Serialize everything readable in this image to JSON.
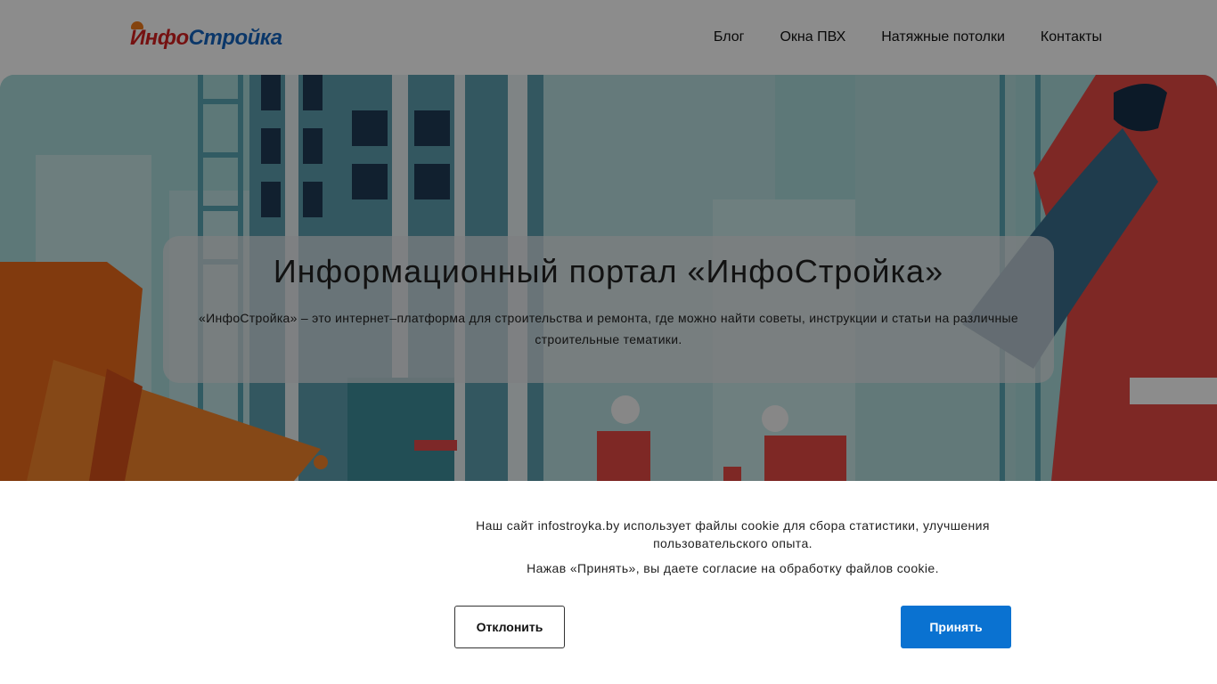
{
  "header": {
    "logo": {
      "part1": "Инфо",
      "part2": "Стройка"
    },
    "nav": [
      {
        "label": "Блог"
      },
      {
        "label": "Окна ПВХ"
      },
      {
        "label": "Натяжные потолки"
      },
      {
        "label": "Контакты"
      }
    ]
  },
  "hero": {
    "title": "Информационный портал «ИнфоСтройка»",
    "description": "«ИнфоСтройка» – это интернет–платформа для строительства и ремонта, где можно найти советы, инструкции и статьи на различные строительные тематики."
  },
  "cookie": {
    "text1": "Наш сайт infostroyka.by использует файлы cookie для сбора статистики, улучшения пользовательского опыта.",
    "text2": "Нажав «Принять», вы даете согласие на обработку файлов cookie.",
    "decline_label": "Отклонить",
    "accept_label": "Принять"
  },
  "colors": {
    "accent": "#0a72d1",
    "logo_red": "#d6201f",
    "logo_blue": "#1565c0"
  }
}
